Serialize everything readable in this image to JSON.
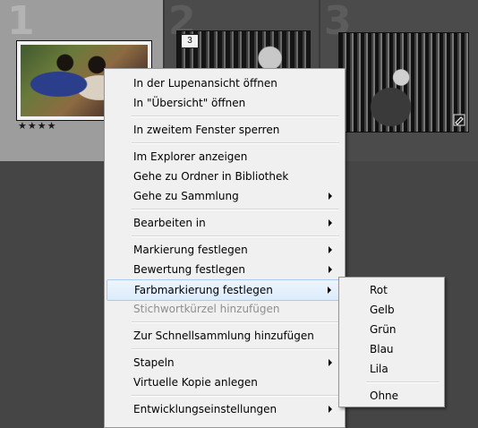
{
  "filmstrip": {
    "cells": [
      {
        "number": "1",
        "selected": true,
        "rating": "★★★★"
      },
      {
        "number": "2",
        "badge": "3"
      },
      {
        "number": "3"
      }
    ]
  },
  "context_menu": {
    "items": [
      {
        "label": "In der Lupenansicht öffnen"
      },
      {
        "label": "In \"Übersicht\" öffnen"
      },
      {
        "label": "In zweitem Fenster sperren"
      },
      {
        "label": "Im Explorer anzeigen"
      },
      {
        "label": "Gehe zu Ordner in Bibliothek"
      },
      {
        "label": "Gehe zu Sammlung",
        "submenu": true
      },
      {
        "label": "Bearbeiten in",
        "submenu": true
      },
      {
        "label": "Markierung festlegen",
        "submenu": true
      },
      {
        "label": "Bewertung festlegen",
        "submenu": true
      },
      {
        "label": "Farbmarkierung festlegen",
        "submenu": true,
        "highlighted": true
      },
      {
        "label": "Stichwortkürzel hinzufügen",
        "disabled": true
      },
      {
        "label": "Zur Schnellsammlung hinzufügen"
      },
      {
        "label": "Stapeln",
        "submenu": true
      },
      {
        "label": "Virtuelle Kopie anlegen"
      },
      {
        "label": "Entwicklungseinstellungen",
        "submenu": true
      }
    ]
  },
  "color_submenu": {
    "items": [
      {
        "label": "Rot"
      },
      {
        "label": "Gelb"
      },
      {
        "label": "Grün"
      },
      {
        "label": "Blau"
      },
      {
        "label": "Lila"
      },
      {
        "label": "Ohne"
      }
    ]
  },
  "colors": {
    "menu_background": "#f0f0f0",
    "highlight_border": "#a8cbf1",
    "disabled_text": "#8f8f8f",
    "selected_cell": "#9d9d9d"
  }
}
